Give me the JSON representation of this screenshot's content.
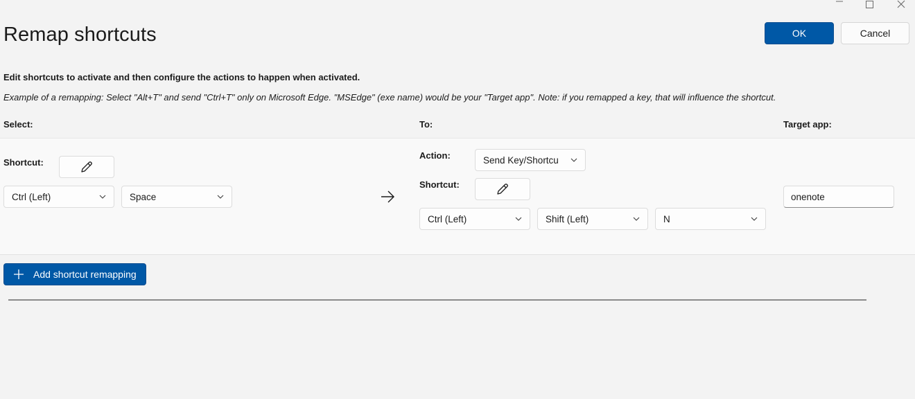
{
  "window": {
    "title": "Remap shortcuts"
  },
  "header": {
    "ok_label": "OK",
    "cancel_label": "Cancel"
  },
  "description": {
    "instruction": "Edit shortcuts to activate and then configure the actions to happen when activated.",
    "example": "Example of a remapping: Select \"Alt+T\" and send \"Ctrl+T\" only on Microsoft Edge. \"MSEdge\" (exe name) would be your \"Target app\". Note: if you remapped a key, that will influence the shortcut."
  },
  "columns": {
    "select": "Select:",
    "to": "To:",
    "target_app": "Target app:"
  },
  "remapping": {
    "select": {
      "shortcut_label": "Shortcut:",
      "keys": [
        "Ctrl (Left)",
        "Space"
      ]
    },
    "to": {
      "action_label": "Action:",
      "action_value": "Send Key/Shortcu",
      "shortcut_label": "Shortcut:",
      "keys": [
        "Ctrl (Left)",
        "Shift (Left)",
        "N"
      ]
    },
    "target_app_value": "onenote"
  },
  "add_button_label": "Add shortcut remapping",
  "colors": {
    "accent": "#0058a6",
    "background": "#f3f3f3",
    "row_background": "#f9f9f9"
  },
  "icons": {
    "edit": "pencil-icon",
    "arrow": "arrow-right-icon",
    "add": "plus-icon",
    "dropdown": "chevron-down-icon"
  }
}
